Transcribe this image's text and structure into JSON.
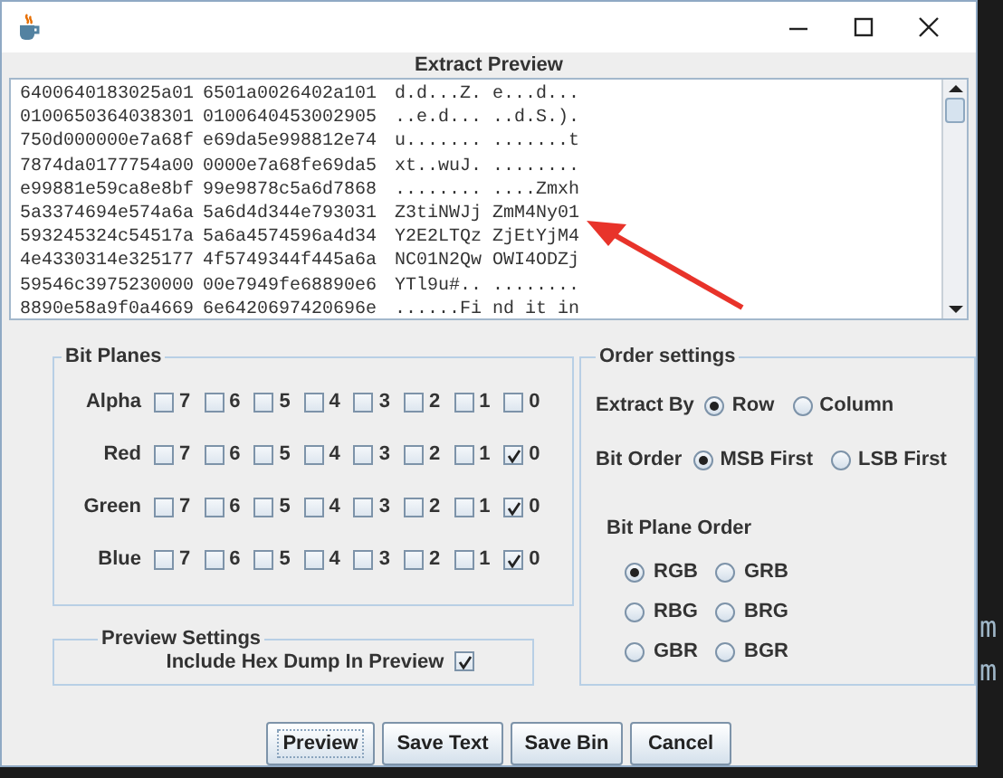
{
  "window": {
    "title_bar_buttons": [
      {
        "kind": "minimize"
      },
      {
        "kind": "maximize"
      },
      {
        "kind": "close"
      }
    ]
  },
  "preview": {
    "title": "Extract Preview",
    "rows": [
      {
        "hex_1": "6400640183025a01",
        "hex_2": "6501a0026402a101",
        "ascii_1": "d.d...Z.",
        "ascii_2": "e...d..."
      },
      {
        "hex_1": "0100650364038301",
        "hex_2": "0100640453002905",
        "ascii_1": "..e.d...",
        "ascii_2": "..d.S.)."
      },
      {
        "hex_1": "750d000000e7a68f",
        "hex_2": "e69da5e998812e74",
        "ascii_1": "u.......",
        "ascii_2": ".......t"
      },
      {
        "hex_1": "7874da0177754a00",
        "hex_2": "0000e7a68fe69da5",
        "ascii_1": "xt..wuJ.",
        "ascii_2": "........"
      },
      {
        "hex_1": "e99881e59ca8e8bf",
        "hex_2": "99e9878c5a6d7868",
        "ascii_1": "........",
        "ascii_2": "....Zmxh"
      },
      {
        "hex_1": "5a3374694e574a6a",
        "hex_2": "5a6d4d344e793031",
        "ascii_1": "Z3tiNWJj",
        "ascii_2": "ZmM4Ny01"
      },
      {
        "hex_1": "593245324c54517a",
        "hex_2": "5a6a4574596a4d34",
        "ascii_1": "Y2E2LTQz",
        "ascii_2": "ZjEtYjM4"
      },
      {
        "hex_1": "4e4330314e325177",
        "hex_2": "4f5749344f445a6a",
        "ascii_1": "NC01N2Qw",
        "ascii_2": "OWI4ODZj"
      },
      {
        "hex_1": "59546c3975230000",
        "hex_2": "00e7949fe68890e6",
        "ascii_1": "YTl9u#..",
        "ascii_2": "........"
      },
      {
        "hex_1": "8890e58a9f0a4669",
        "hex_2": "6e6420697420696e",
        "ascii_1": "......Fi",
        "ascii_2": "nd it in"
      }
    ]
  },
  "bit_planes": {
    "title": "Bit Planes",
    "rows": [
      {
        "label": "Alpha",
        "bits": [
          {
            "label": "7",
            "checked": false
          },
          {
            "label": "6",
            "checked": false
          },
          {
            "label": "5",
            "checked": false
          },
          {
            "label": "4",
            "checked": false
          },
          {
            "label": "3",
            "checked": false
          },
          {
            "label": "2",
            "checked": false
          },
          {
            "label": "1",
            "checked": false
          },
          {
            "label": "0",
            "checked": false
          }
        ]
      },
      {
        "label": "Red",
        "bits": [
          {
            "label": "7",
            "checked": false
          },
          {
            "label": "6",
            "checked": false
          },
          {
            "label": "5",
            "checked": false
          },
          {
            "label": "4",
            "checked": false
          },
          {
            "label": "3",
            "checked": false
          },
          {
            "label": "2",
            "checked": false
          },
          {
            "label": "1",
            "checked": false
          },
          {
            "label": "0",
            "checked": true
          }
        ]
      },
      {
        "label": "Green",
        "bits": [
          {
            "label": "7",
            "checked": false
          },
          {
            "label": "6",
            "checked": false
          },
          {
            "label": "5",
            "checked": false
          },
          {
            "label": "4",
            "checked": false
          },
          {
            "label": "3",
            "checked": false
          },
          {
            "label": "2",
            "checked": false
          },
          {
            "label": "1",
            "checked": false
          },
          {
            "label": "0",
            "checked": true
          }
        ]
      },
      {
        "label": "Blue",
        "bits": [
          {
            "label": "7",
            "checked": false
          },
          {
            "label": "6",
            "checked": false
          },
          {
            "label": "5",
            "checked": false
          },
          {
            "label": "4",
            "checked": false
          },
          {
            "label": "3",
            "checked": false
          },
          {
            "label": "2",
            "checked": false
          },
          {
            "label": "1",
            "checked": false
          },
          {
            "label": "0",
            "checked": true
          }
        ]
      }
    ]
  },
  "preview_settings": {
    "title": "Preview Settings",
    "include_hex_dump": {
      "label": "Include Hex Dump In Preview",
      "checked": true
    }
  },
  "order_settings": {
    "title": "Order settings",
    "extract_by": {
      "label": "Extract By",
      "options": [
        {
          "label": "Row",
          "selected": true
        },
        {
          "label": "Column",
          "selected": false
        }
      ]
    },
    "bit_order": {
      "label": "Bit Order",
      "options": [
        {
          "label": "MSB First",
          "selected": true
        },
        {
          "label": "LSB First",
          "selected": false
        }
      ]
    },
    "bit_plane_order": {
      "title": "Bit Plane Order",
      "options": [
        {
          "label": "RGB",
          "selected": true
        },
        {
          "label": "GRB",
          "selected": false
        },
        {
          "label": "RBG",
          "selected": false
        },
        {
          "label": "BRG",
          "selected": false
        },
        {
          "label": "GBR",
          "selected": false
        },
        {
          "label": "BGR",
          "selected": false
        }
      ]
    }
  },
  "buttons": [
    {
      "label": "Preview",
      "focused": true
    },
    {
      "label": "Save Text",
      "focused": false
    },
    {
      "label": "Save Bin",
      "focused": false
    },
    {
      "label": "Cancel",
      "focused": false
    }
  ],
  "background_text": [
    "m",
    "m"
  ]
}
